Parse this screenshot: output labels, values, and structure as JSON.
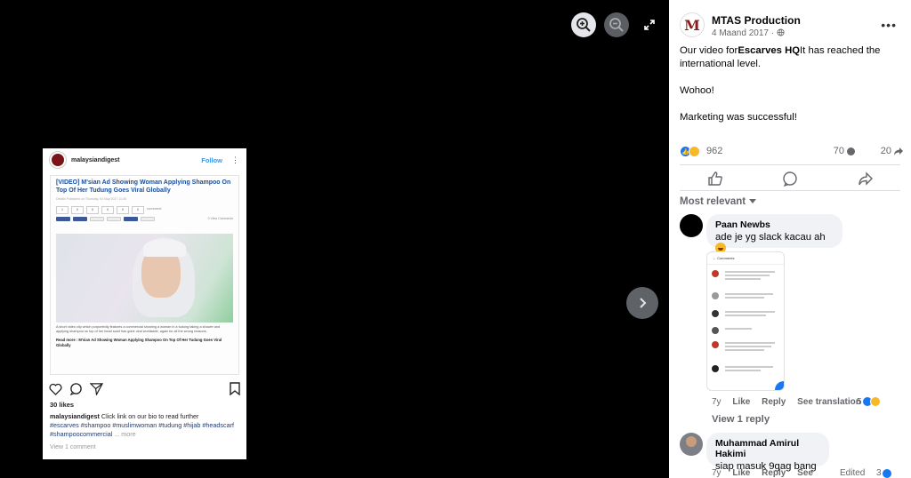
{
  "viewer": {
    "icons": [
      "zoom-in-icon",
      "zoom-out-icon",
      "expand-icon",
      "chevron-right-icon"
    ],
    "embedded_post": {
      "username": "malaysiandigest",
      "follow_label": "Follow",
      "article_title": "[VIDEO] M'sian Ad Showing Woman Applying Shampoo On Top Of Her Tudung Goes Viral Globally",
      "article_meta": "Details  Published on Thursday, 04 May 2017 11:45",
      "share_counts": [
        "1",
        "0",
        "0",
        "0",
        "0",
        "0"
      ],
      "share_label": "comment",
      "view_comments": "0 View Comments",
      "article_caption": "A short video clip which purportedly features a commercial showing a woman in a tudung taking a shower and applying shampoo on top of her head scarf has gone viral worldwide, again for all the wrong reasons.",
      "read_more": "Read more : M'sian Ad Showing Woman Applying Shampoo On Top Of Her Tudung Goes Viral Globally",
      "likes": "30 likes",
      "caption_user": "malaysiandigest",
      "caption_text": " Click link on our bio to read further",
      "hashtags": "#escarves #shampoo #muslimwoman #tudung #hijab #headscarf #shampoocommercial",
      "more": "... more",
      "view_comment": "View 1 comment"
    }
  },
  "post": {
    "page_name": "MTAS Production",
    "date": "4 Maand 2017 · ",
    "logo_letter": "M",
    "text_before": "Our video for",
    "text_bold": "Escarves HQ",
    "text_after": "It has reached the international level.",
    "line2": "Wohoo!",
    "line3": "Marketing was successful!",
    "reactions_count": "962",
    "comments_count": "70",
    "shares_count": "20",
    "sort_label": "Most relevant"
  },
  "comments": [
    {
      "author": "Paan Newbs",
      "text": "ade je yg slack kacau ah",
      "age": "7y",
      "like": "Like",
      "reply": "Reply",
      "see_translation": "See translation",
      "reaction_count": "5",
      "view_replies": "View 1 reply",
      "shot_title": "Comments"
    },
    {
      "author": "Muhammad Amirul Hakimi",
      "text": "siap masuk 9gag bang",
      "age": "7y",
      "like": "Like",
      "reply": "Reply",
      "see": "See",
      "edited": "Edited",
      "reaction_count": "3"
    }
  ],
  "colors": {
    "accent": "#1877f2",
    "haha": "#f7b928",
    "brand": "#8b1a1a"
  }
}
